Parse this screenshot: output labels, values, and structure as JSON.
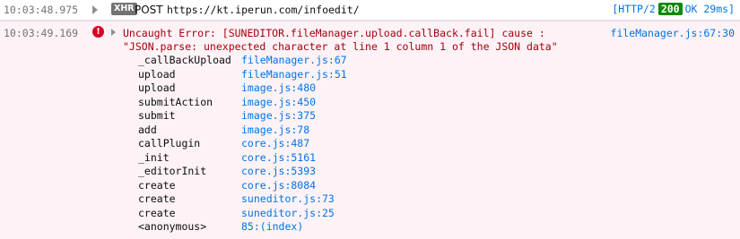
{
  "xhr": {
    "timestamp": "10:03:48.975",
    "badge": "XHR",
    "method": "POST",
    "url": "https://kt.iperun.com/infoedit/",
    "protocol": "[HTTP/2",
    "status_code": "200",
    "status_text": "OK 29ms]"
  },
  "error": {
    "timestamp": "10:03:49.169",
    "icon": "error-icon",
    "message_line1": "Uncaught Error: [SUNEDITOR.fileManager.upload.callBack.fail] cause :",
    "message_line2": "\"JSON.parse: unexpected character at line 1 column 1 of the JSON data\"",
    "source": "fileManager.js:67:30",
    "stack": [
      {
        "fn": "_callBackUpload",
        "loc": "fileManager.js:67"
      },
      {
        "fn": "upload",
        "loc": "fileManager.js:51"
      },
      {
        "fn": "upload",
        "loc": "image.js:480"
      },
      {
        "fn": "submitAction",
        "loc": "image.js:450"
      },
      {
        "fn": "submit",
        "loc": "image.js:375"
      },
      {
        "fn": "add",
        "loc": "image.js:78"
      },
      {
        "fn": "callPlugin",
        "loc": "core.js:487"
      },
      {
        "fn": "_init",
        "loc": "core.js:5161"
      },
      {
        "fn": "_editorInit",
        "loc": "core.js:5393"
      },
      {
        "fn": "create",
        "loc": "core.js:8084"
      },
      {
        "fn": "create",
        "loc": "suneditor.js:73"
      },
      {
        "fn": "create",
        "loc": "suneditor.js:25"
      },
      {
        "fn": "<anonymous>",
        "loc": "85:(index)"
      }
    ]
  },
  "colors": {
    "error_text": "#a4000f",
    "link": "#0074e8",
    "error_bg": "#fdf2f5",
    "status_ok": "#058b00"
  }
}
